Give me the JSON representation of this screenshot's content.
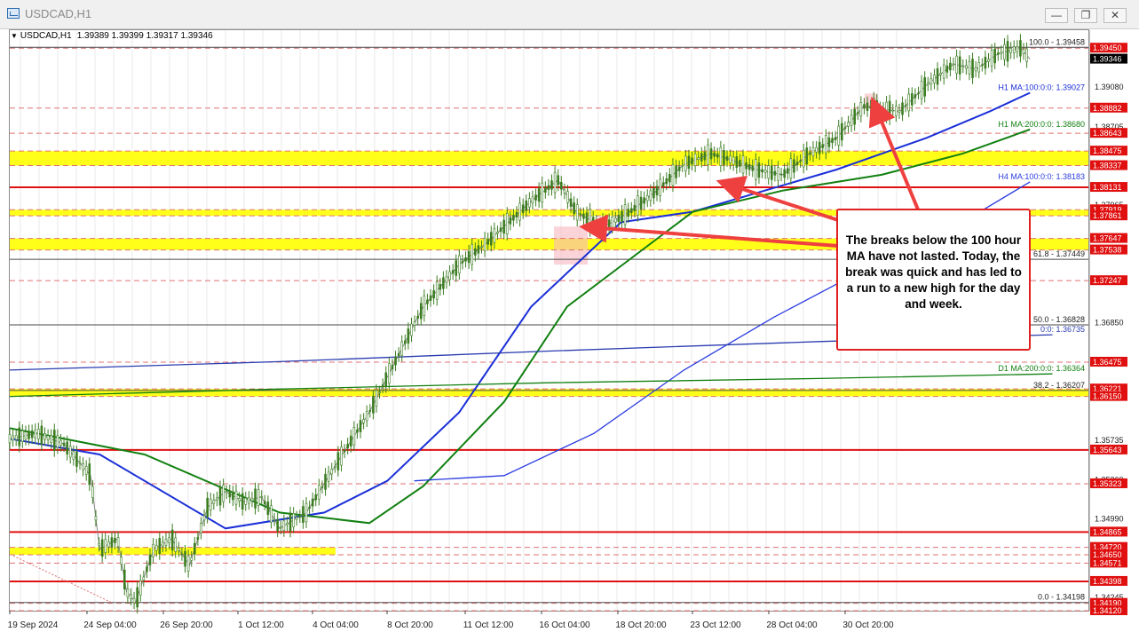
{
  "window": {
    "title": "USDCAD,H1",
    "minimize_label": "—",
    "maximize_label": "❐",
    "close_label": "✕",
    "icon": "chart-window-icon"
  },
  "header": {
    "symbol": "USDCAD,H1",
    "ohlc": "1.39389 1.39399 1.39317 1.39346"
  },
  "annotation": {
    "text": "The breaks below the 100 hour MA have not lasted. Today, the break was quick and has led to a run to a new high for the day and week."
  },
  "colors": {
    "candle": "#3c7d22",
    "price_line": "#8a8a8a",
    "red_line": "#e01010",
    "red_dash": "#e07070",
    "yellow_zone": "#ffff00",
    "ma_100h": "#1a2fd8",
    "ma_200h": "#118011",
    "ma_100h4": "#2a3ce0",
    "ma_200d": "#118011",
    "ma_100d": "#2a3cb0",
    "fib_line": "#4a4a4a",
    "arrow": "#ef4040",
    "price_tag_red": "#e01010",
    "price_tag_current": "#000000"
  },
  "chart_data": {
    "type": "line",
    "title": "USDCAD,H1",
    "ylim": [
      1.3412,
      1.3962
    ],
    "x_ticks": [
      "19 Sep 2024",
      "24 Sep 04:00",
      "26 Sep 20:00",
      "1 Oct 12:00",
      "4 Oct 04:00",
      "8 Oct 20:00",
      "11 Oct 12:00",
      "16 Oct 04:00",
      "18 Oct 20:00",
      "23 Oct 12:00",
      "28 Oct 04:00",
      "30 Oct 20:00"
    ],
    "y_axis_labels": [
      "1.39080",
      "1.38705",
      "1.37965",
      "1.37861",
      "1.36850",
      "1.35735",
      "1.35360",
      "1.34990",
      "1.34245"
    ],
    "x_count": 12,
    "price_path": [
      [
        0,
        1.3575
      ],
      [
        0.3,
        1.358
      ],
      [
        0.6,
        1.357
      ],
      [
        0.9,
        1.354
      ],
      [
        1.0,
        1.347
      ],
      [
        1.2,
        1.348
      ],
      [
        1.3,
        1.343
      ],
      [
        1.4,
        1.342
      ],
      [
        1.6,
        1.347
      ],
      [
        1.8,
        1.348
      ],
      [
        2.0,
        1.3455
      ],
      [
        2.2,
        1.351
      ],
      [
        2.4,
        1.3525
      ],
      [
        2.6,
        1.3515
      ],
      [
        2.8,
        1.352
      ],
      [
        3.0,
        1.349
      ],
      [
        3.3,
        1.3505
      ],
      [
        3.7,
        1.356
      ],
      [
        4.0,
        1.36
      ],
      [
        4.3,
        1.365
      ],
      [
        4.6,
        1.37
      ],
      [
        5.0,
        1.374
      ],
      [
        5.3,
        1.376
      ],
      [
        5.8,
        1.38
      ],
      [
        6.1,
        1.382
      ],
      [
        6.3,
        1.379
      ],
      [
        6.6,
        1.3775
      ],
      [
        6.9,
        1.379
      ],
      [
        7.2,
        1.381
      ],
      [
        7.5,
        1.3835
      ],
      [
        7.8,
        1.3845
      ],
      [
        8.0,
        1.384
      ],
      [
        8.3,
        1.383
      ],
      [
        8.6,
        1.3825
      ],
      [
        8.9,
        1.3845
      ],
      [
        9.2,
        1.386
      ],
      [
        9.5,
        1.389
      ],
      [
        9.9,
        1.3885
      ],
      [
        10.2,
        1.391
      ],
      [
        10.5,
        1.393
      ],
      [
        10.75,
        1.3925
      ],
      [
        11.0,
        1.394
      ],
      [
        11.25,
        1.3945
      ],
      [
        11.35,
        1.39346
      ]
    ],
    "series": [
      {
        "name": "H1 MA:100:0:0: 1.39027",
        "points": [
          [
            0,
            1.3575
          ],
          [
            1,
            1.356
          ],
          [
            2.4,
            1.349
          ],
          [
            3.5,
            1.3505
          ],
          [
            4.2,
            1.3535
          ],
          [
            5.0,
            1.36
          ],
          [
            5.8,
            1.37
          ],
          [
            6.8,
            1.378
          ],
          [
            7.6,
            1.379
          ],
          [
            8.4,
            1.381
          ],
          [
            9.2,
            1.383
          ],
          [
            10.2,
            1.386
          ],
          [
            10.9,
            1.3885
          ],
          [
            11.35,
            1.39027
          ]
        ]
      },
      {
        "name": "H1 MA:200:0:0: 1.38680",
        "points": [
          [
            0,
            1.3585
          ],
          [
            1.5,
            1.356
          ],
          [
            3.0,
            1.3505
          ],
          [
            4.0,
            1.3495
          ],
          [
            4.6,
            1.353
          ],
          [
            5.5,
            1.361
          ],
          [
            6.2,
            1.37
          ],
          [
            6.9,
            1.3745
          ],
          [
            7.6,
            1.379
          ],
          [
            8.6,
            1.381
          ],
          [
            9.7,
            1.3825
          ],
          [
            10.6,
            1.3845
          ],
          [
            11.35,
            1.3868
          ]
        ]
      },
      {
        "name": "H4 MA:100:0:0: 1.38183",
        "points": [
          [
            4.5,
            1.3535
          ],
          [
            5.5,
            1.354
          ],
          [
            6.5,
            1.358
          ],
          [
            7.5,
            1.364
          ],
          [
            8.5,
            1.369
          ],
          [
            9.5,
            1.3735
          ],
          [
            10.4,
            1.377
          ],
          [
            11.35,
            1.38183
          ]
        ]
      },
      {
        "name": "D1 MA:200:0:0: 1.36364",
        "points": [
          [
            0,
            1.3615
          ],
          [
            3,
            1.3622
          ],
          [
            6,
            1.3628
          ],
          [
            9,
            1.3632
          ],
          [
            11.6,
            1.36364
          ]
        ]
      },
      {
        "name": "D1 MA:100:0:0: 1.36735",
        "points": [
          [
            0,
            1.364
          ],
          [
            3,
            1.3648
          ],
          [
            6,
            1.3658
          ],
          [
            9,
            1.3667
          ],
          [
            11.6,
            1.36735
          ]
        ]
      }
    ],
    "fibonacci": [
      {
        "label": "100.0 - 1.39458",
        "value": 1.39458
      },
      {
        "label": "61.8 - 1.37449",
        "value": 1.37449
      },
      {
        "label": "50.0 - 1.36828",
        "value": 1.36828
      },
      {
        "label": "38.2 - 1.36207",
        "value": 1.36207
      },
      {
        "label": "0.0 - 1.34198",
        "value": 1.34198
      }
    ],
    "yellow_zones": [
      [
        1.38337,
        1.38475
      ],
      [
        1.37861,
        1.37919
      ],
      [
        1.37538,
        1.37647
      ],
      [
        1.3615,
        1.36221
      ],
      [
        1.3465,
        1.3472
      ]
    ],
    "red_levels_solid": [
      1.38131,
      1.35643,
      1.34865,
      1.34398
    ],
    "red_levels_dashed": [
      1.3945,
      1.38882,
      1.38643,
      1.38475,
      1.38337,
      1.37919,
      1.37861,
      1.37647,
      1.37538,
      1.37247,
      1.36475,
      1.36221,
      1.3615,
      1.35323,
      1.3472,
      1.3465,
      1.34571,
      1.3419,
      1.3412
    ],
    "price_tags_red": [
      "1.39450",
      "1.38882",
      "1.38643",
      "1.38475",
      "1.38337",
      "1.38131",
      "1.37919",
      "1.37861",
      "1.37647",
      "1.37538",
      "1.37247",
      "1.36475",
      "1.36221",
      "1.36150",
      "1.35643",
      "1.35323",
      "1.34865",
      "1.34720",
      "1.34650",
      "1.34571",
      "1.34398",
      "1.34190",
      "1.34120"
    ],
    "current_price": "1.39346",
    "ma_labels": [
      {
        "text": "H1 MA:100:0:0: 1.39027",
        "value": 1.39027,
        "color": "#1a2fd8"
      },
      {
        "text": "H1 MA:200:0:0: 1.38680",
        "value": 1.3868,
        "color": "#118011"
      },
      {
        "text": "H4 MA:100:0:0: 1.38183",
        "value": 1.38183,
        "color": "#2a3ce0"
      },
      {
        "text": "D1 MA:200:0:0: 1.36364",
        "value": 1.36364,
        "color": "#118011"
      },
      {
        "text": "0:0: 1.36735",
        "value": 1.36735,
        "color": "#2a3cb0"
      }
    ]
  }
}
